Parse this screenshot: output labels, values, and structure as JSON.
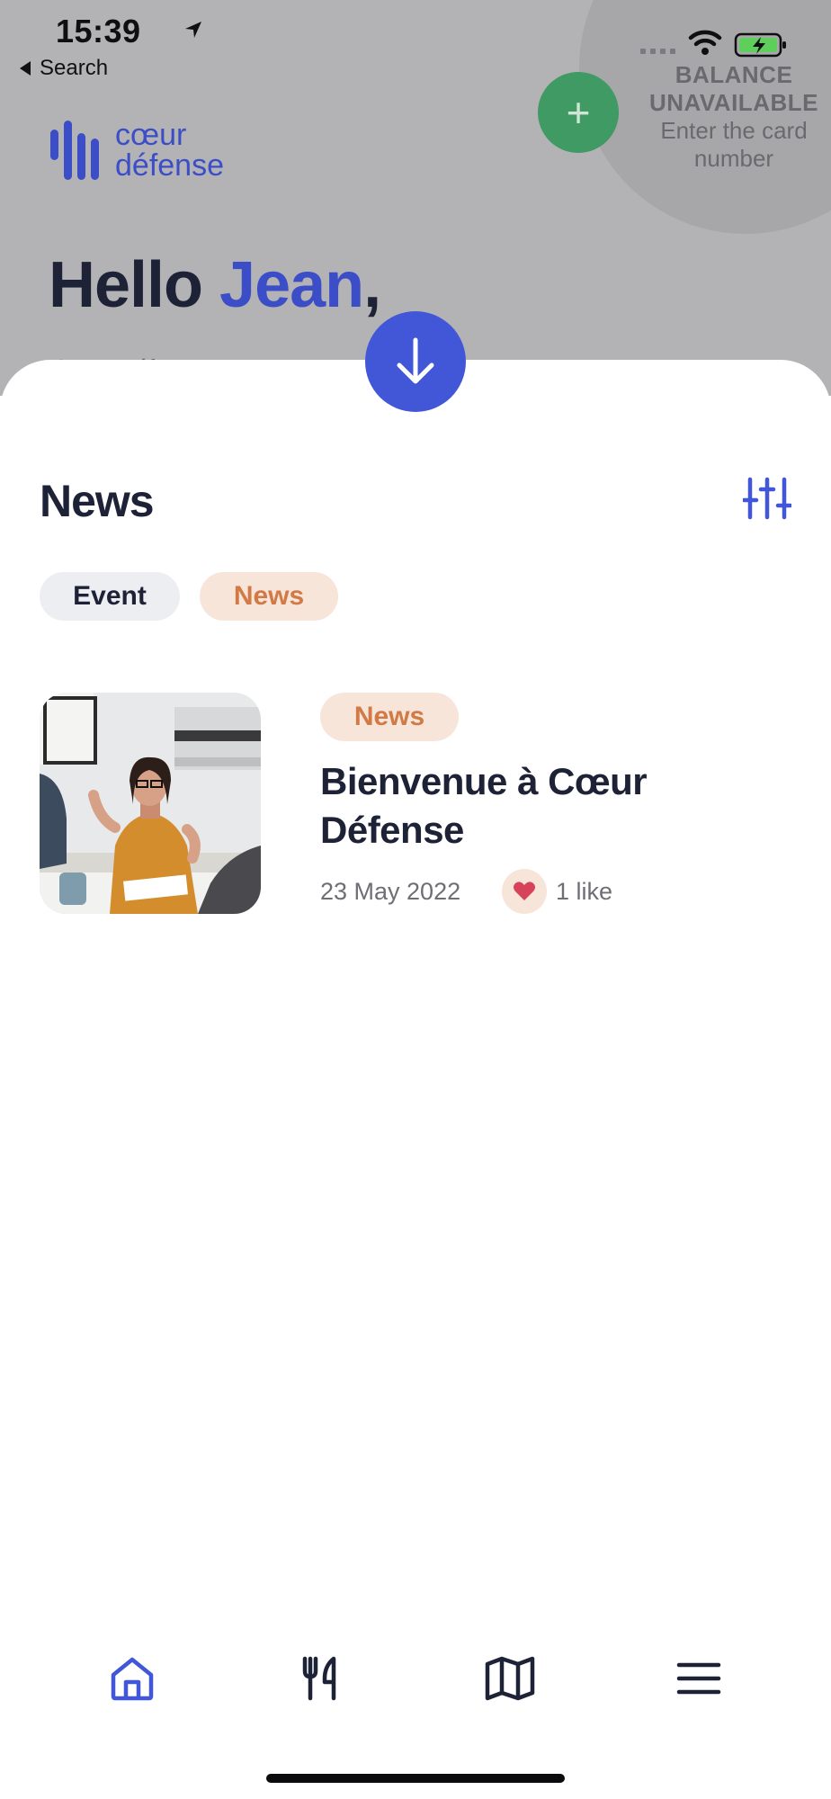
{
  "status_bar": {
    "time": "15:39",
    "back_label": "Search"
  },
  "header": {
    "balance_title": "BALANCE UNAVAILABLE",
    "balance_subtitle": "Enter the card number",
    "add_button": "+",
    "logo_line1": "cœur",
    "logo_line2": "défense",
    "greeting": "Hello ",
    "user_name": "Jean",
    "greeting_suffix": ",",
    "subtitle": "Cœur Déf..."
  },
  "news": {
    "title": "News",
    "filters": [
      {
        "label": "Event",
        "active": false
      },
      {
        "label": "News",
        "active": true
      }
    ],
    "items": [
      {
        "category": "News",
        "title": "Bienvenue à Cœur Défense",
        "date": "23 May 2022",
        "likes": "1 like"
      }
    ]
  },
  "tab_bar": {
    "tabs": [
      {
        "icon": "home-icon",
        "active": true
      },
      {
        "icon": "fork-knife-icon",
        "active": false
      },
      {
        "icon": "map-icon",
        "active": false
      },
      {
        "icon": "menu-icon",
        "active": false
      }
    ]
  },
  "colors": {
    "brand": "#3b4ec7",
    "accent_button": "#4157d8",
    "add_button": "#3f9a64",
    "news_chip": "#f7e5da",
    "news_text": "#d17a45",
    "dark_text": "#1d2236"
  }
}
